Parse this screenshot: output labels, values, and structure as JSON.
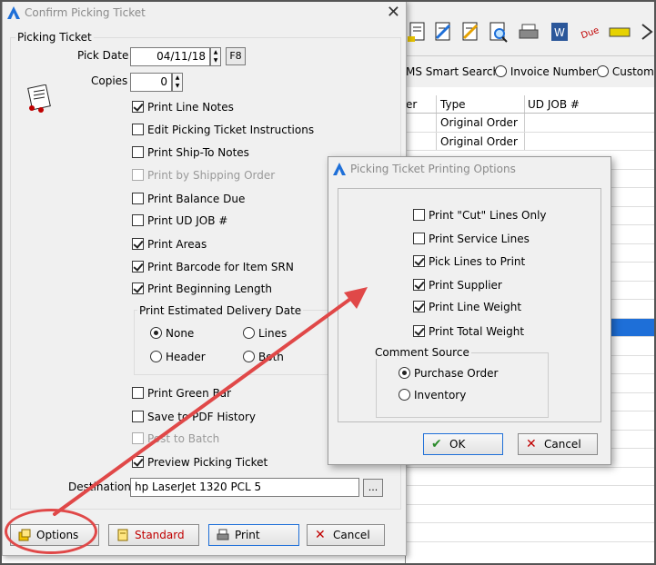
{
  "background_app": {
    "search_options": [
      "MS Smart Search",
      "Invoice Number",
      "Custome"
    ],
    "table": {
      "columns": [
        "er",
        "Type",
        "UD JOB #"
      ],
      "rows": [
        {
          "type": "Original Order"
        },
        {
          "type": "Original Order"
        }
      ]
    },
    "toolbar_icons": [
      "document-icon",
      "edit-document-icon",
      "edit-document-icon",
      "search-document-icon",
      "printer-icon",
      "word-icon",
      "due-icon",
      "tape-icon",
      "chevron-icon"
    ]
  },
  "main_dialog": {
    "title": "Confirm Picking Ticket",
    "group_title": "Picking Ticket",
    "pick_date_label": "Pick Date",
    "pick_date_value": "04/11/18",
    "f8_label": "F8",
    "copies_label": "Copies",
    "copies_value": "0",
    "checkboxes": [
      {
        "label": "Print Line Notes",
        "checked": true,
        "enabled": true
      },
      {
        "label": "Edit Picking Ticket Instructions",
        "checked": false,
        "enabled": true
      },
      {
        "label": "Print Ship-To Notes",
        "checked": false,
        "enabled": true
      },
      {
        "label": "Print by Shipping Order",
        "checked": false,
        "enabled": false
      },
      {
        "label": "Print Balance Due",
        "checked": false,
        "enabled": true
      },
      {
        "label": "Print UD JOB #",
        "checked": false,
        "enabled": true
      },
      {
        "label": "Print Areas",
        "checked": true,
        "enabled": true
      },
      {
        "label": "Print Barcode for Item SRN",
        "checked": true,
        "enabled": true
      },
      {
        "label": "Print Beginning Length",
        "checked": true,
        "enabled": true
      }
    ],
    "delivery_group_title": "Print Estimated Delivery Date",
    "delivery_options": [
      {
        "label": "None",
        "selected": true
      },
      {
        "label": "Lines",
        "selected": false
      },
      {
        "label": "Header",
        "selected": false
      },
      {
        "label": "Both",
        "selected": false
      }
    ],
    "checkboxes_lower": [
      {
        "label": "Print Green Bar",
        "checked": false,
        "enabled": true
      },
      {
        "label": "Save to PDF History",
        "checked": false,
        "enabled": true
      },
      {
        "label": "Post to Batch",
        "checked": false,
        "enabled": false
      },
      {
        "label": "Preview Picking Ticket",
        "checked": true,
        "enabled": true
      }
    ],
    "destination_label": "Destination",
    "destination_value": "hp LaserJet 1320 PCL 5",
    "browse_label": "...",
    "buttons": {
      "options": "Options",
      "standard": "Standard",
      "print": "Print",
      "cancel": "Cancel"
    }
  },
  "options_dialog": {
    "title": "Picking Ticket Printing Options",
    "checkboxes": [
      {
        "label": "Print \"Cut\" Lines Only",
        "checked": false
      },
      {
        "label": "Print Service Lines",
        "checked": false
      },
      {
        "label": "Pick Lines to Print",
        "checked": true
      },
      {
        "label": "Print Supplier",
        "checked": true
      },
      {
        "label": "Print Line Weight",
        "checked": true
      },
      {
        "label": "Print Total Weight",
        "checked": true
      }
    ],
    "comment_source_title": "Comment Source",
    "comment_sources": [
      {
        "label": "Purchase Order",
        "selected": true
      },
      {
        "label": "Inventory",
        "selected": false
      }
    ],
    "ok_label": "OK",
    "cancel_label": "Cancel"
  },
  "colors": {
    "accent_blue": "#1e6fd8",
    "annotation_red": "#e04848",
    "standard_text_red": "#c00000"
  }
}
